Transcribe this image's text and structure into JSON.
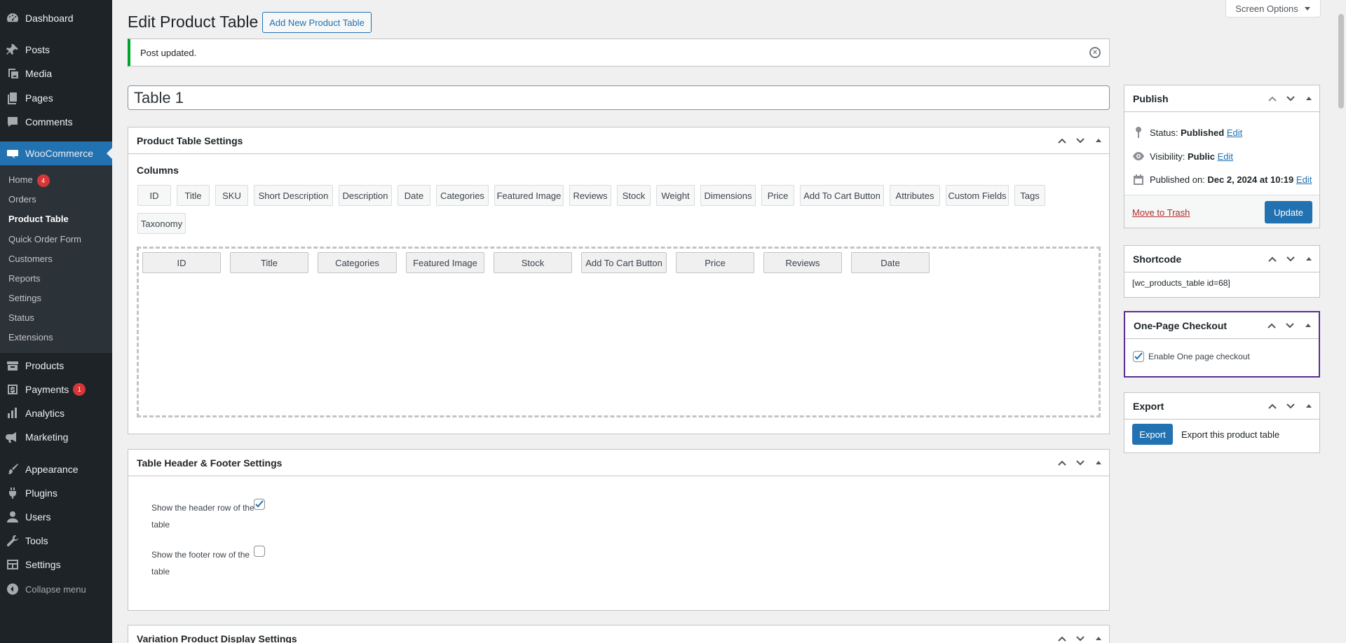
{
  "sidebar": {
    "items": [
      {
        "label": "Dashboard",
        "icon": "dashboard-icon"
      },
      {
        "label": "Posts",
        "icon": "pushpin-icon"
      },
      {
        "label": "Media",
        "icon": "media-icon"
      },
      {
        "label": "Pages",
        "icon": "pages-icon"
      },
      {
        "label": "Comments",
        "icon": "comment-icon"
      },
      {
        "label": "WooCommerce",
        "icon": "woocommerce-icon"
      },
      {
        "label": "Products",
        "icon": "archive-icon"
      },
      {
        "label": "Payments",
        "icon": "dollar-icon",
        "badge": "1"
      },
      {
        "label": "Analytics",
        "icon": "bar-chart-icon"
      },
      {
        "label": "Marketing",
        "icon": "megaphone-icon"
      },
      {
        "label": "Appearance",
        "icon": "paintbrush-icon"
      },
      {
        "label": "Plugins",
        "icon": "plugin-icon"
      },
      {
        "label": "Users",
        "icon": "user-icon"
      },
      {
        "label": "Tools",
        "icon": "wrench-icon"
      },
      {
        "label": "Settings",
        "icon": "settings-icon"
      }
    ],
    "submenu": [
      {
        "label": "Home",
        "badge": "4"
      },
      {
        "label": "Orders"
      },
      {
        "label": "Product Table"
      },
      {
        "label": "Quick Order Form"
      },
      {
        "label": "Customers"
      },
      {
        "label": "Reports"
      },
      {
        "label": "Settings"
      },
      {
        "label": "Status"
      },
      {
        "label": "Extensions"
      }
    ],
    "collapse_label": "Collapse menu"
  },
  "header": {
    "title": "Edit Product Table",
    "add_new_label": "Add New Product Table",
    "screen_options_label": "Screen Options"
  },
  "notice": {
    "text": "Post updated."
  },
  "post_title": "Table 1",
  "settings_box": {
    "title": "Product Table Settings",
    "columns_label": "Columns",
    "available": [
      "ID",
      "Title",
      "SKU",
      "Short Description",
      "Description",
      "Date",
      "Categories",
      "Featured Image",
      "Reviews",
      "Stock",
      "Weight",
      "Dimensions",
      "Price",
      "Add To Cart Button",
      "Attributes",
      "Custom Fields",
      "Tags",
      "Taxonomy"
    ],
    "selected": [
      "ID",
      "Title",
      "Categories",
      "Featured Image",
      "Stock",
      "Add To Cart Button",
      "Price",
      "Reviews",
      "Date"
    ]
  },
  "header_footer_box": {
    "title": "Table Header & Footer Settings",
    "header_row_label_1": "Show the header row of the",
    "header_row_label_2": "table",
    "header_row_checked": true,
    "footer_row_label_1": "Show the footer row of the",
    "footer_row_label_2": "table",
    "footer_row_checked": false
  },
  "variation_box": {
    "title": "Variation Product Display Settings"
  },
  "publish_box": {
    "title": "Publish",
    "status_label": "Status:",
    "status_value": "Published",
    "visibility_label": "Visibility:",
    "visibility_value": "Public",
    "published_label": "Published on:",
    "published_value": "Dec 2, 2024 at 10:19",
    "edit_label": "Edit",
    "trash_label": "Move to Trash",
    "update_label": "Update"
  },
  "shortcode_box": {
    "title": "Shortcode",
    "value": "[wc_products_table id=68]"
  },
  "checkout_box": {
    "title": "One-Page Checkout",
    "checkbox_label": "Enable One page checkout",
    "checked": true,
    "accent": "#5c2d91"
  },
  "export_box": {
    "title": "Export",
    "button_label": "Export",
    "description": "Export this product table"
  },
  "colors": {
    "primary": "#2271b1",
    "sidebar": "#1d2327",
    "notice_success": "#00a32a",
    "danger": "#b32d2e"
  }
}
